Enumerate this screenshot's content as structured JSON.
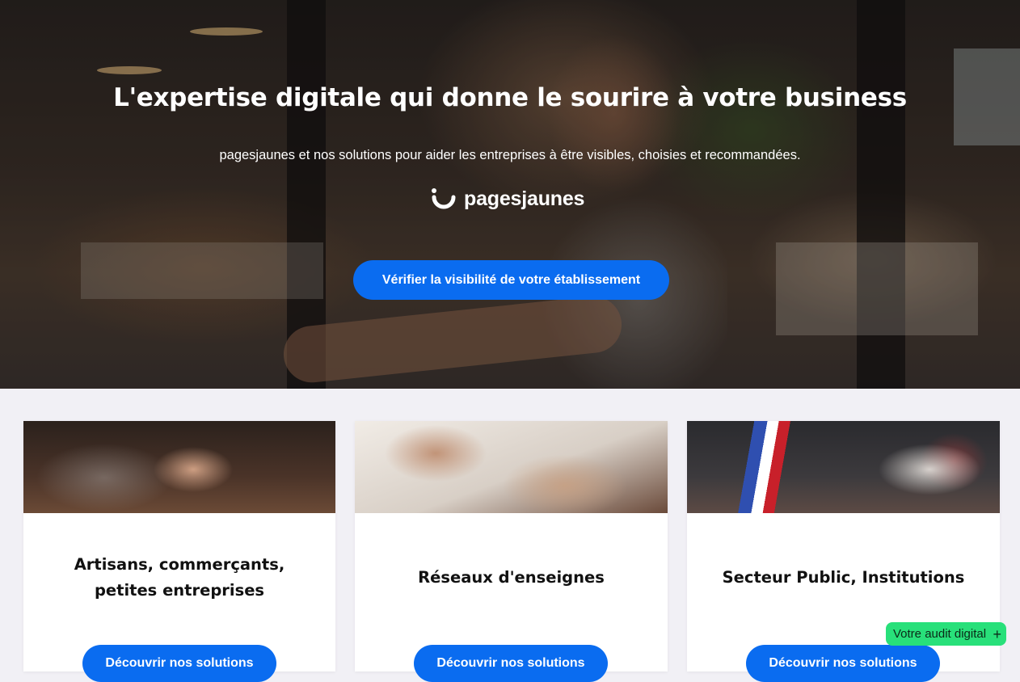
{
  "hero": {
    "title": "L'expertise digitale qui donne le sourire à votre business",
    "subtitle": "pagesjaunes et nos solutions pour aider les entreprises à être visibles, choisies et recommandées.",
    "brand_name": "pagesjaunes",
    "brand_icon": "pagesjaunes-smile-icon",
    "cta_label": "Vérifier la visibilité de votre établissement"
  },
  "cards": [
    {
      "title_line1": "Artisans, commerçants,",
      "title_line2": "petites entreprises",
      "button_label": "Découvrir nos solutions",
      "image": "artisan-flour-hands-photo"
    },
    {
      "title": "Réseaux d'enseignes",
      "button_label": "Découvrir nos solutions",
      "image": "signing-document-photo"
    },
    {
      "title": "Secteur Public, Institutions",
      "button_label": "Découvrir nos solutions",
      "image": "mayor-tricolor-sash-photo"
    }
  ],
  "audit": {
    "label": "Votre audit digital",
    "icon": "plus-icon"
  },
  "colors": {
    "primary_blue": "#0a6cf0",
    "audit_green": "#28e07a",
    "page_bg": "#f1f0f5"
  }
}
